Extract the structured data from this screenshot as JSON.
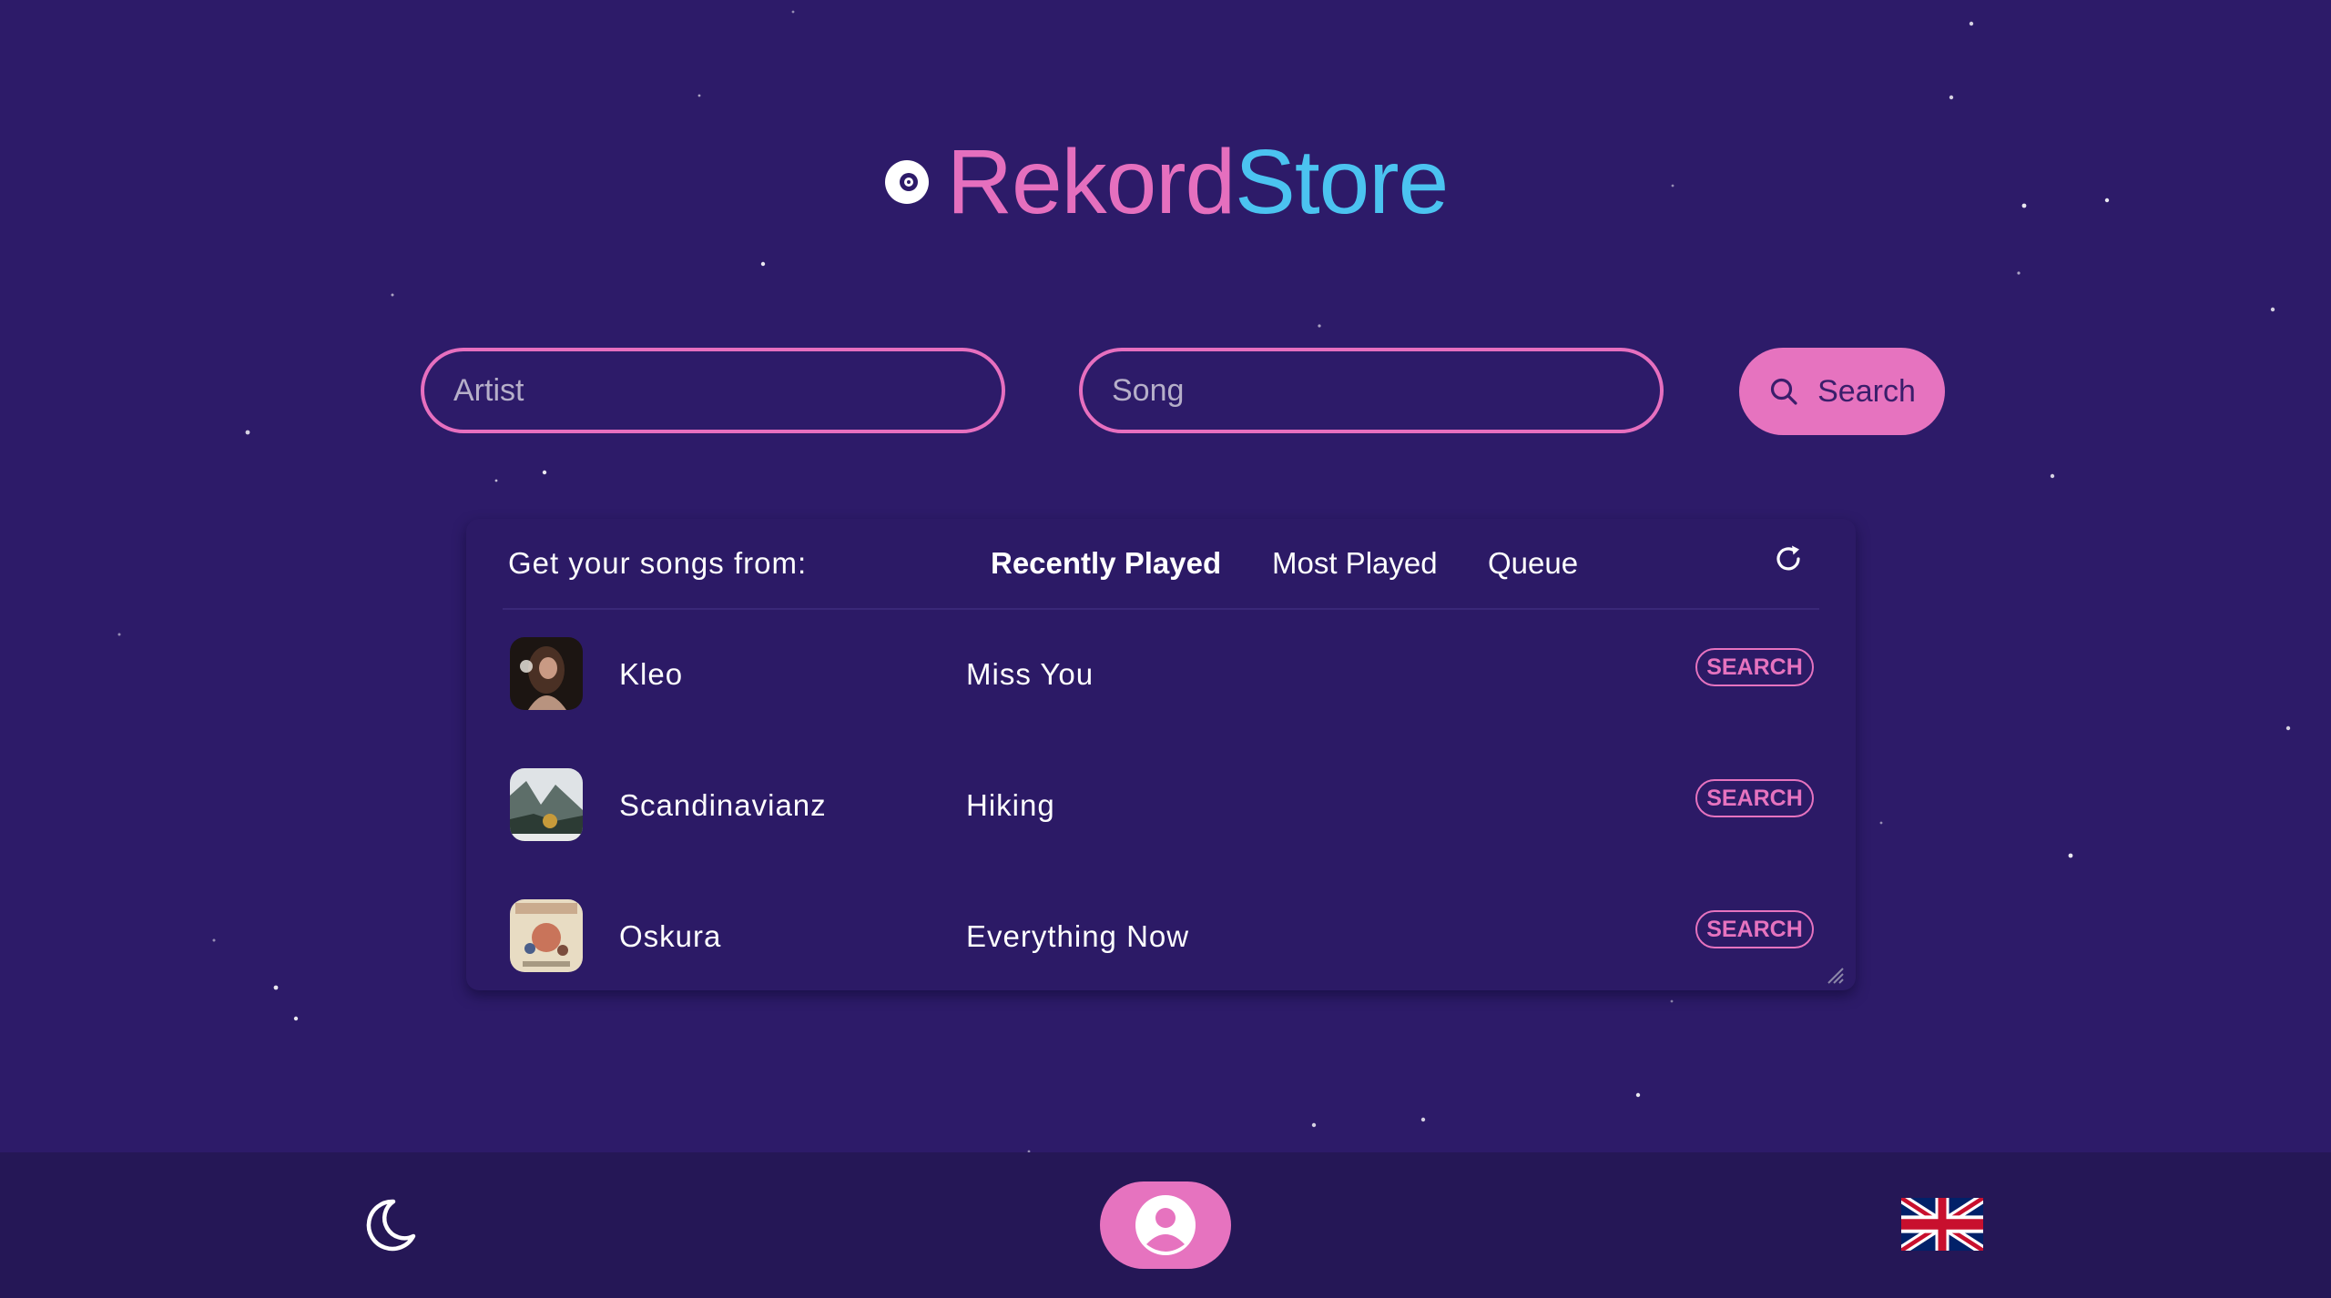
{
  "app": {
    "title_part1": "Rekord",
    "title_part2": "Store",
    "accent_pink": "#e673bf",
    "accent_blue": "#4bc3f0",
    "background": "#2d1b69"
  },
  "search": {
    "artist_placeholder": "Artist",
    "song_placeholder": "Song",
    "button_label": "Search",
    "button_icon": "search-icon"
  },
  "source_panel": {
    "label": "Get your songs from:",
    "tabs": [
      {
        "label": "Recently Played",
        "active": true
      },
      {
        "label": "Most Played",
        "active": false
      },
      {
        "label": "Queue",
        "active": false
      }
    ],
    "refresh_icon": "refresh-icon"
  },
  "tracks": [
    {
      "artist": "Kleo",
      "song": "Miss You",
      "action": "SEARCH"
    },
    {
      "artist": "Scandinavianz",
      "song": "Hiking",
      "action": "SEARCH"
    },
    {
      "artist": "Oskura",
      "song": "Everything Now",
      "action": "SEARCH"
    }
  ],
  "footer": {
    "theme_icon": "moon-icon",
    "profile_icon": "user-profile-icon",
    "language_icon": "uk-flag-icon"
  }
}
